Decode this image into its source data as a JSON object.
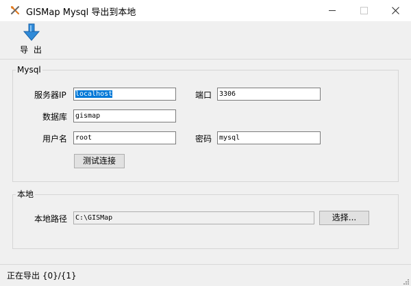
{
  "window": {
    "title": "GISMap Mysql 导出到本地"
  },
  "toolbar": {
    "export_label": "导 出"
  },
  "mysql": {
    "group_title": "Mysql",
    "server_ip_label": "服务器IP",
    "server_ip_value": "localhost",
    "port_label": "端口",
    "port_value": "3306",
    "database_label": "数据库",
    "database_value": "gismap",
    "user_label": "用户名",
    "user_value": "root",
    "password_label": "密码",
    "password_value": "mysql",
    "test_button_label": "测试连接"
  },
  "local": {
    "group_title": "本地",
    "path_label": "本地路径",
    "path_value": "C:\\GISMap",
    "browse_button_label": "选择..."
  },
  "status": {
    "text": "正在导出 {0}/{1}"
  },
  "colors": {
    "selection": "#0078d7",
    "window_bg": "#f0f0f0",
    "export_arrow": "#2f8ad8"
  },
  "icons": {
    "app": "tools-icon",
    "export": "download-arrow-icon"
  }
}
